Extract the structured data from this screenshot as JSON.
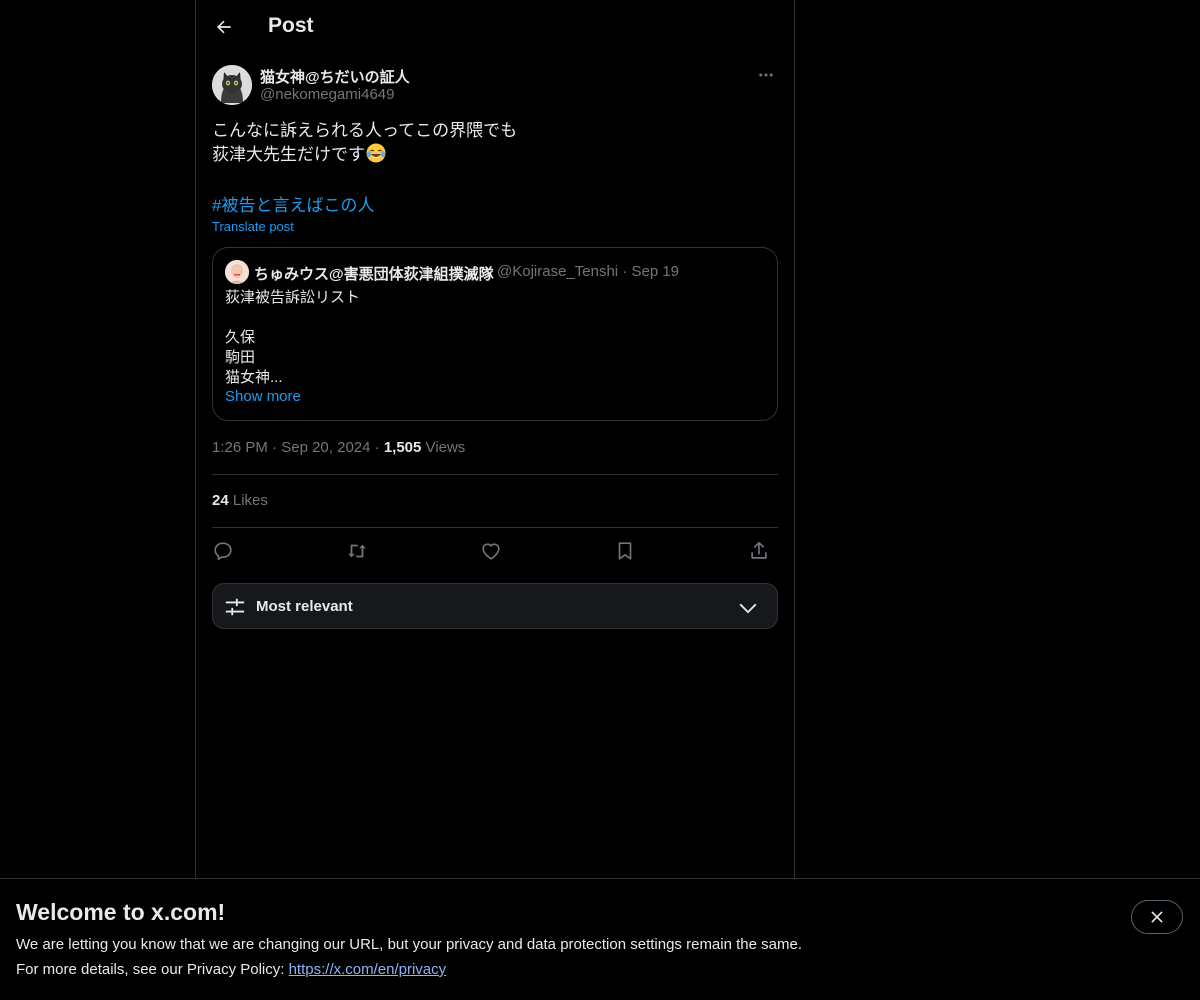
{
  "header": {
    "title": "Post",
    "back_icon": "arrow-left-icon"
  },
  "post": {
    "author_name": "猫女神@ちだいの証人",
    "author_handle": "@nekomegami4649",
    "text_lines": [
      "こんなに訴えられる人ってこの界隈でも",
      "荻津大先生だけです"
    ],
    "emoji": "face-with-tears-of-joy",
    "hashtag": "#被告と言えばこの人",
    "translate_label": "Translate post",
    "time": "1:26 PM",
    "date": "Sep 20, 2024",
    "views_count": "1,505",
    "views_label": "Views",
    "likes_count": "24",
    "likes_label": "Likes"
  },
  "quote": {
    "author_name": "ちゅみウス@害悪団体荻津組撲滅隊",
    "author_handle": "@Kojirase_Tenshi",
    "date": "Sep 19",
    "text_lines": [
      "荻津被告訴訟リスト",
      "",
      "久保",
      "駒田",
      "猫女神..."
    ],
    "show_more": "Show more"
  },
  "actions": {
    "reply_icon": "reply-icon",
    "repost_icon": "repost-icon",
    "like_icon": "heart-icon",
    "bookmark_icon": "bookmark-icon",
    "share_icon": "share-icon"
  },
  "sort": {
    "label": "Most relevant"
  },
  "banner": {
    "title": "Welcome to x.com!",
    "line1": "We are letting you know that we are changing our URL, but your privacy and data protection settings remain the same.",
    "line2_prefix": "For more details, see our Privacy Policy: ",
    "link": "https://x.com/en/privacy"
  },
  "colors": {
    "background": "#000000",
    "text": "#e7e9ea",
    "muted": "#71767b",
    "accent": "#1d9bf0",
    "border": "#2f3336"
  }
}
